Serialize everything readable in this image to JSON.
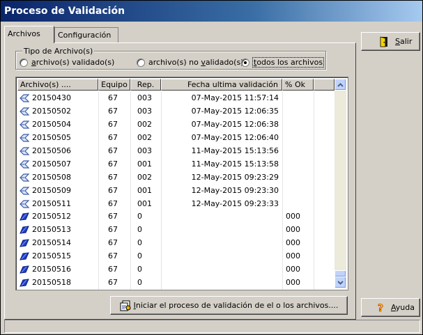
{
  "window": {
    "title": "Proceso de Validación"
  },
  "tabs": [
    {
      "label": "Archivos",
      "active": true
    },
    {
      "label": "Configuración",
      "active": false
    }
  ],
  "filter": {
    "group_label": "Tipo de Archivo(s)",
    "options": [
      {
        "label": "archivo(s) validado(s)",
        "mnemonic": "a",
        "rest": "rchivo(s) validado(s)",
        "checked": false
      },
      {
        "label": "archivo(s) no validado(s)",
        "pre": "archivo(s) no ",
        "mnemonic": "v",
        "rest": "alidado(s)",
        "checked": false
      },
      {
        "label": "todos los archivos",
        "mnemonic": "t",
        "rest": "odos los archivos",
        "checked": true
      }
    ]
  },
  "file_list": {
    "columns": [
      "Archivo(s) ....",
      "Equipo",
      "Rep.",
      "Fecha ultima validación",
      "% Ok"
    ],
    "rows": [
      {
        "archivo": "20150430",
        "equipo": "67",
        "rep": "003",
        "fecha": "07-May-2015 11:57:14",
        "pct": "",
        "icon": "validated-file-icon"
      },
      {
        "archivo": "20150502",
        "equipo": "67",
        "rep": "003",
        "fecha": "07-May-2015 12:06:35",
        "pct": "",
        "icon": "validated-file-icon"
      },
      {
        "archivo": "20150504",
        "equipo": "67",
        "rep": "002",
        "fecha": "07-May-2015 12:06:38",
        "pct": "",
        "icon": "validated-file-icon"
      },
      {
        "archivo": "20150505",
        "equipo": "67",
        "rep": "002",
        "fecha": "07-May-2015 12:06:40",
        "pct": "",
        "icon": "validated-file-icon"
      },
      {
        "archivo": "20150506",
        "equipo": "67",
        "rep": "003",
        "fecha": "11-May-2015 15:13:56",
        "pct": "",
        "icon": "validated-file-icon"
      },
      {
        "archivo": "20150507",
        "equipo": "67",
        "rep": "001",
        "fecha": "11-May-2015 15:13:58",
        "pct": "",
        "icon": "validated-file-icon"
      },
      {
        "archivo": "20150508",
        "equipo": "67",
        "rep": "002",
        "fecha": "12-May-2015 09:23:29",
        "pct": "",
        "icon": "validated-file-icon"
      },
      {
        "archivo": "20150509",
        "equipo": "67",
        "rep": "001",
        "fecha": "12-May-2015 09:23:30",
        "pct": "",
        "icon": "validated-file-icon"
      },
      {
        "archivo": "20150511",
        "equipo": "67",
        "rep": "001",
        "fecha": "12-May-2015 09:23:33",
        "pct": "",
        "icon": "validated-file-icon"
      },
      {
        "archivo": "20150512",
        "equipo": "67",
        "rep": "0",
        "fecha": "",
        "pct": "000",
        "icon": "unvalidated-file-icon"
      },
      {
        "archivo": "20150513",
        "equipo": "67",
        "rep": "0",
        "fecha": "",
        "pct": "000",
        "icon": "unvalidated-file-icon"
      },
      {
        "archivo": "20150514",
        "equipo": "67",
        "rep": "0",
        "fecha": "",
        "pct": "000",
        "icon": "unvalidated-file-icon"
      },
      {
        "archivo": "20150515",
        "equipo": "67",
        "rep": "0",
        "fecha": "",
        "pct": "000",
        "icon": "unvalidated-file-icon"
      },
      {
        "archivo": "20150516",
        "equipo": "67",
        "rep": "0",
        "fecha": "",
        "pct": "000",
        "icon": "unvalidated-file-icon"
      },
      {
        "archivo": "20150518",
        "equipo": "67",
        "rep": "0",
        "fecha": "",
        "pct": "000",
        "icon": "unvalidated-file-icon"
      }
    ]
  },
  "buttons": {
    "start": {
      "mnemonic": "I",
      "rest": "niciar el proceso de validación de el o los archivos....",
      "icon": "process-icon"
    },
    "salir": {
      "mnemonic": "S",
      "rest": "alir",
      "icon": "exit-door-icon"
    },
    "ayuda": {
      "mnemonic": "A",
      "rest": "yuda",
      "icon": "help-icon"
    }
  },
  "colors": {
    "title_start": "#0a246a",
    "title_end": "#a6caf0",
    "face": "#d4d0c8",
    "validated_icon": "#3a5ba8",
    "unvalidated_icon": "#1f3fc9"
  }
}
